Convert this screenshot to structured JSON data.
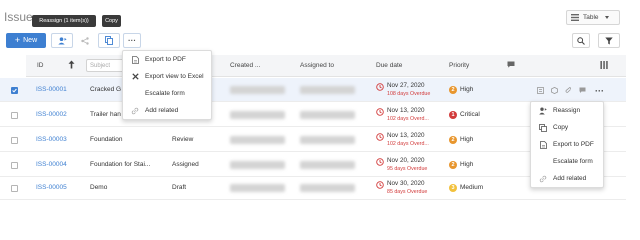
{
  "page": {
    "title": "Issue"
  },
  "view_select": {
    "label": "Table"
  },
  "toolbar": {
    "new_label": "New",
    "tooltip_reassign": "Reassign (1 item(s))",
    "tooltip_copy": "Copy",
    "more_label": "···"
  },
  "table": {
    "headers": {
      "id": "ID",
      "subject_placeholder": "Subject",
      "created": "Created ...",
      "assigned_to": "Assigned to",
      "due_date": "Due date",
      "priority": "Priority"
    },
    "rows": [
      {
        "id": "ISS-00001",
        "subject": "Cracked G",
        "status": "",
        "due_date": "Nov 27, 2020",
        "overdue": "108 days Overdue",
        "priority": "High"
      },
      {
        "id": "ISS-00002",
        "subject": "Trailer han",
        "status": "",
        "due_date": "Nov 13, 2020",
        "overdue": "102 days Overd...",
        "priority": "Critical"
      },
      {
        "id": "ISS-00003",
        "subject": "Foundation",
        "status": "Review",
        "due_date": "Nov 13, 2020",
        "overdue": "102 days Overd...",
        "priority": "High"
      },
      {
        "id": "ISS-00004",
        "subject": "Foundation for Stai...",
        "status": "Assigned",
        "due_date": "Nov 20, 2020",
        "overdue": "95 days Overdue",
        "priority": "High"
      },
      {
        "id": "ISS-00005",
        "subject": "Demo",
        "status": "Draft",
        "due_date": "Nov 30, 2020",
        "overdue": "85 days Overdue",
        "priority": "Medium"
      }
    ]
  },
  "toolbar_menu": {
    "items": [
      {
        "label": "Export to PDF",
        "icon": "pdf-icon"
      },
      {
        "label": "Export view to Excel",
        "icon": "excel-icon"
      },
      {
        "label": "Escalate form",
        "icon": ""
      },
      {
        "label": "Add related",
        "icon": "link-icon"
      }
    ]
  },
  "row_menu": {
    "items": [
      {
        "label": "Reassign",
        "icon": "reassign-icon"
      },
      {
        "label": "Copy",
        "icon": "copy-icon"
      },
      {
        "label": "Export to PDF",
        "icon": "pdf-icon"
      },
      {
        "label": "Escalate form",
        "icon": ""
      },
      {
        "label": "Add related",
        "icon": "link-icon"
      }
    ]
  },
  "colors": {
    "accent": "#3d7fd1",
    "high": "#e8962e",
    "critical": "#d23b3b",
    "medium": "#f2c13c",
    "overdue": "#d23b3b"
  }
}
